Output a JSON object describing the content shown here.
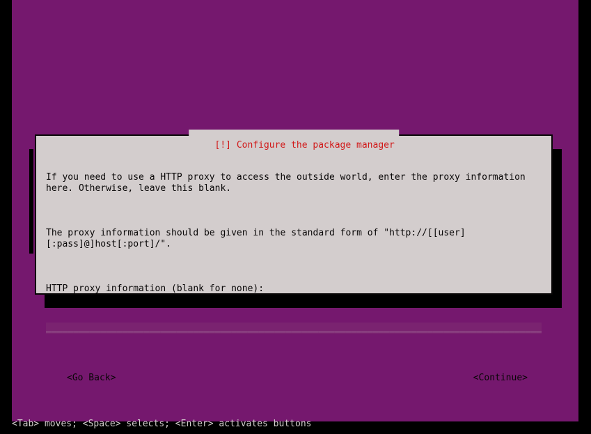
{
  "dialog": {
    "title": "[!] Configure the package manager",
    "paragraph1": "If you need to use a HTTP proxy to access the outside world, enter the proxy information here. Otherwise, leave this blank.",
    "paragraph2": "The proxy information should be given in the standard form of \"http://[[user][:pass]@]host[:port]/\".",
    "prompt": "HTTP proxy information (blank for none):",
    "input_value": "",
    "go_back": "<Go Back>",
    "continue": "<Continue>"
  },
  "underline_fill": "_____________________________________________________________________________________________",
  "helpbar": "<Tab> moves; <Space> selects; <Enter> activates buttons"
}
